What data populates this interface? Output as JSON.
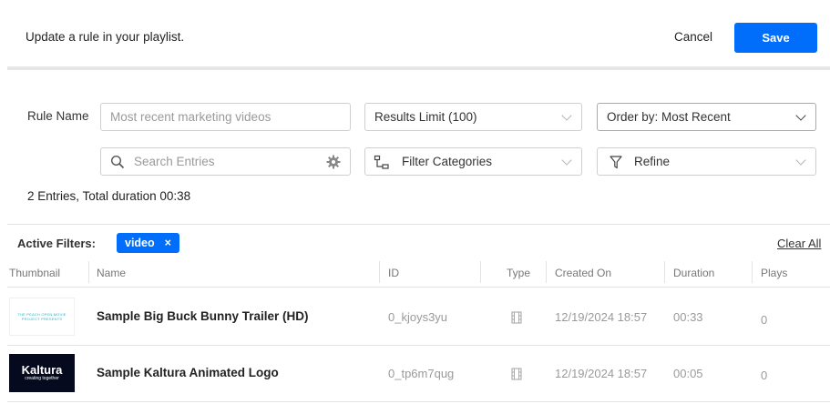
{
  "header": {
    "title": "Update a rule in your playlist.",
    "cancel_label": "Cancel",
    "save_label": "Save"
  },
  "form": {
    "rule_name_label": "Rule Name",
    "rule_name_placeholder": "Most recent marketing videos",
    "results_limit": "Results Limit (100)",
    "order_by": "Order by: Most Recent",
    "search_placeholder": "Search Entries",
    "filter_categories": "Filter Categories",
    "refine": "Refine"
  },
  "summary": "2 Entries, Total duration 00:38",
  "filters": {
    "label": "Active Filters:",
    "chip": "video",
    "chip_remove": "×",
    "clear_all": "Clear All"
  },
  "table": {
    "columns": [
      "Thumbnail",
      "Name",
      "ID",
      "Type",
      "Created On",
      "Duration",
      "Plays"
    ],
    "rows": [
      {
        "name": "Sample Big Buck Bunny Trailer (HD)",
        "id": "0_kjoys3yu",
        "created": "12/19/2024 18:57",
        "duration": "00:33",
        "plays": "0"
      },
      {
        "name": "Sample Kaltura Animated Logo",
        "id": "0_tp6m7qug",
        "created": "12/19/2024 18:57",
        "duration": "00:05",
        "plays": "0"
      }
    ]
  },
  "thumbnails": {
    "row1_text": "THE PEACH OPEN MOVIE PROJECT PRESENTS",
    "row2_logo": "Kaltura",
    "row2_tagline": "creating together"
  },
  "colors": {
    "accent": "#006efa",
    "thumb2_bg": "#050a1e"
  },
  "icons": [
    "search-icon",
    "gear-icon",
    "category-tree-icon",
    "filter-funnel-icon",
    "chevron-down-icon",
    "video-type-icon"
  ]
}
